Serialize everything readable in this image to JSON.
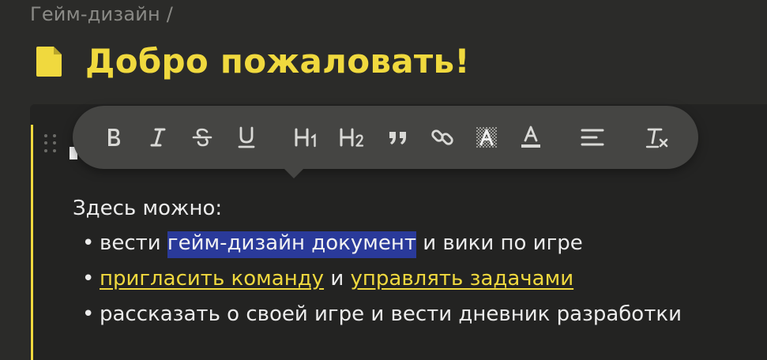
{
  "breadcrumb": {
    "text": "Гейм-дизайн /"
  },
  "page": {
    "title": "Добро пожаловать!",
    "icon": "page-icon",
    "accent_color": "#f0d93e"
  },
  "toolbar": {
    "buttons": [
      {
        "name": "bold-button",
        "icon": "bold-icon"
      },
      {
        "name": "italic-button",
        "icon": "italic-icon"
      },
      {
        "name": "strikethrough-button",
        "icon": "strikethrough-icon"
      },
      {
        "name": "underline-button",
        "icon": "underline-icon"
      },
      {
        "name": "heading1-button",
        "icon": "heading1-icon"
      },
      {
        "name": "heading2-button",
        "icon": "heading2-icon"
      },
      {
        "name": "quote-button",
        "icon": "quote-icon"
      },
      {
        "name": "link-button",
        "icon": "link-icon"
      },
      {
        "name": "highlight-button",
        "icon": "highlight-icon"
      },
      {
        "name": "text-color-button",
        "icon": "text-color-icon"
      },
      {
        "name": "align-button",
        "icon": "align-left-icon"
      },
      {
        "name": "clear-format-button",
        "icon": "clear-format-icon"
      }
    ]
  },
  "content": {
    "intro": "Здесь можно:",
    "bullet": "•",
    "item1": {
      "before": "вести ",
      "selected": "гейм-дизайн документ",
      "after": " и вики по игре"
    },
    "item2": {
      "link1": "пригласить команду",
      "middle": " и ",
      "link2": "управлять задачами"
    },
    "item3": {
      "text": "рассказать о своей игре и вести дневник разработки"
    }
  },
  "colors": {
    "selection": "#2a3a9a",
    "toolbar_bg": "#454543",
    "background": "#2b2b29"
  }
}
